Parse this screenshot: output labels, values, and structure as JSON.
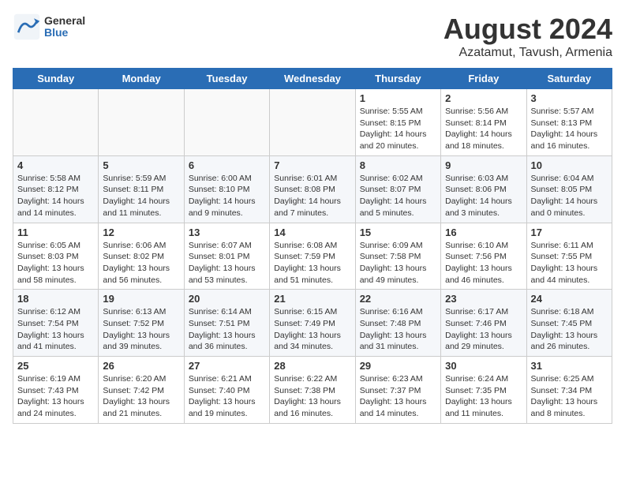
{
  "header": {
    "logo_general": "General",
    "logo_blue": "Blue",
    "title": "August 2024",
    "subtitle": "Azatamut, Tavush, Armenia"
  },
  "weekdays": [
    "Sunday",
    "Monday",
    "Tuesday",
    "Wednesday",
    "Thursday",
    "Friday",
    "Saturday"
  ],
  "weeks": [
    [
      {
        "day": "",
        "info": ""
      },
      {
        "day": "",
        "info": ""
      },
      {
        "day": "",
        "info": ""
      },
      {
        "day": "",
        "info": ""
      },
      {
        "day": "1",
        "info": "Sunrise: 5:55 AM\nSunset: 8:15 PM\nDaylight: 14 hours\nand 20 minutes."
      },
      {
        "day": "2",
        "info": "Sunrise: 5:56 AM\nSunset: 8:14 PM\nDaylight: 14 hours\nand 18 minutes."
      },
      {
        "day": "3",
        "info": "Sunrise: 5:57 AM\nSunset: 8:13 PM\nDaylight: 14 hours\nand 16 minutes."
      }
    ],
    [
      {
        "day": "4",
        "info": "Sunrise: 5:58 AM\nSunset: 8:12 PM\nDaylight: 14 hours\nand 14 minutes."
      },
      {
        "day": "5",
        "info": "Sunrise: 5:59 AM\nSunset: 8:11 PM\nDaylight: 14 hours\nand 11 minutes."
      },
      {
        "day": "6",
        "info": "Sunrise: 6:00 AM\nSunset: 8:10 PM\nDaylight: 14 hours\nand 9 minutes."
      },
      {
        "day": "7",
        "info": "Sunrise: 6:01 AM\nSunset: 8:08 PM\nDaylight: 14 hours\nand 7 minutes."
      },
      {
        "day": "8",
        "info": "Sunrise: 6:02 AM\nSunset: 8:07 PM\nDaylight: 14 hours\nand 5 minutes."
      },
      {
        "day": "9",
        "info": "Sunrise: 6:03 AM\nSunset: 8:06 PM\nDaylight: 14 hours\nand 3 minutes."
      },
      {
        "day": "10",
        "info": "Sunrise: 6:04 AM\nSunset: 8:05 PM\nDaylight: 14 hours\nand 0 minutes."
      }
    ],
    [
      {
        "day": "11",
        "info": "Sunrise: 6:05 AM\nSunset: 8:03 PM\nDaylight: 13 hours\nand 58 minutes."
      },
      {
        "day": "12",
        "info": "Sunrise: 6:06 AM\nSunset: 8:02 PM\nDaylight: 13 hours\nand 56 minutes."
      },
      {
        "day": "13",
        "info": "Sunrise: 6:07 AM\nSunset: 8:01 PM\nDaylight: 13 hours\nand 53 minutes."
      },
      {
        "day": "14",
        "info": "Sunrise: 6:08 AM\nSunset: 7:59 PM\nDaylight: 13 hours\nand 51 minutes."
      },
      {
        "day": "15",
        "info": "Sunrise: 6:09 AM\nSunset: 7:58 PM\nDaylight: 13 hours\nand 49 minutes."
      },
      {
        "day": "16",
        "info": "Sunrise: 6:10 AM\nSunset: 7:56 PM\nDaylight: 13 hours\nand 46 minutes."
      },
      {
        "day": "17",
        "info": "Sunrise: 6:11 AM\nSunset: 7:55 PM\nDaylight: 13 hours\nand 44 minutes."
      }
    ],
    [
      {
        "day": "18",
        "info": "Sunrise: 6:12 AM\nSunset: 7:54 PM\nDaylight: 13 hours\nand 41 minutes."
      },
      {
        "day": "19",
        "info": "Sunrise: 6:13 AM\nSunset: 7:52 PM\nDaylight: 13 hours\nand 39 minutes."
      },
      {
        "day": "20",
        "info": "Sunrise: 6:14 AM\nSunset: 7:51 PM\nDaylight: 13 hours\nand 36 minutes."
      },
      {
        "day": "21",
        "info": "Sunrise: 6:15 AM\nSunset: 7:49 PM\nDaylight: 13 hours\nand 34 minutes."
      },
      {
        "day": "22",
        "info": "Sunrise: 6:16 AM\nSunset: 7:48 PM\nDaylight: 13 hours\nand 31 minutes."
      },
      {
        "day": "23",
        "info": "Sunrise: 6:17 AM\nSunset: 7:46 PM\nDaylight: 13 hours\nand 29 minutes."
      },
      {
        "day": "24",
        "info": "Sunrise: 6:18 AM\nSunset: 7:45 PM\nDaylight: 13 hours\nand 26 minutes."
      }
    ],
    [
      {
        "day": "25",
        "info": "Sunrise: 6:19 AM\nSunset: 7:43 PM\nDaylight: 13 hours\nand 24 minutes."
      },
      {
        "day": "26",
        "info": "Sunrise: 6:20 AM\nSunset: 7:42 PM\nDaylight: 13 hours\nand 21 minutes."
      },
      {
        "day": "27",
        "info": "Sunrise: 6:21 AM\nSunset: 7:40 PM\nDaylight: 13 hours\nand 19 minutes."
      },
      {
        "day": "28",
        "info": "Sunrise: 6:22 AM\nSunset: 7:38 PM\nDaylight: 13 hours\nand 16 minutes."
      },
      {
        "day": "29",
        "info": "Sunrise: 6:23 AM\nSunset: 7:37 PM\nDaylight: 13 hours\nand 14 minutes."
      },
      {
        "day": "30",
        "info": "Sunrise: 6:24 AM\nSunset: 7:35 PM\nDaylight: 13 hours\nand 11 minutes."
      },
      {
        "day": "31",
        "info": "Sunrise: 6:25 AM\nSunset: 7:34 PM\nDaylight: 13 hours\nand 8 minutes."
      }
    ]
  ]
}
